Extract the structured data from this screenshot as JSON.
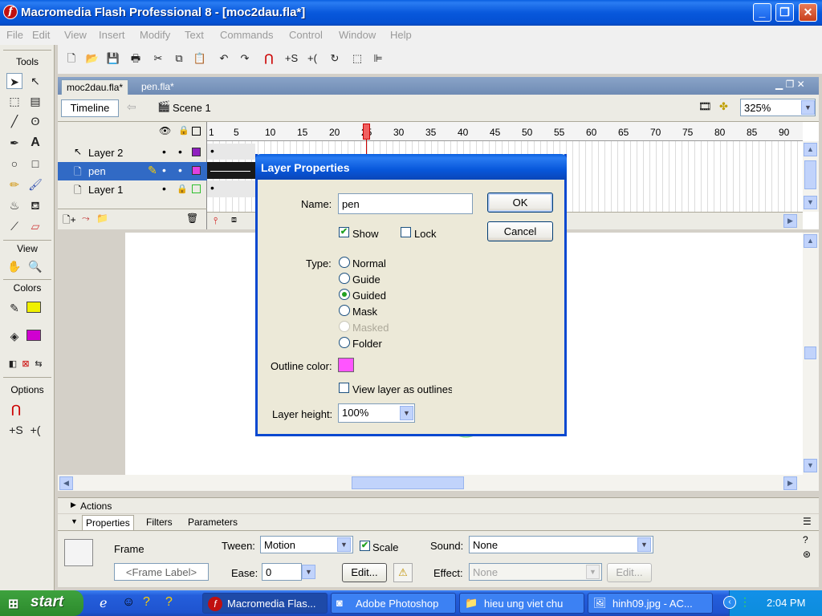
{
  "window": {
    "title": "Macromedia Flash Professional 8 - [moc2dau.fla*]",
    "logo_glyph": "f",
    "controls": {
      "minimize": "_",
      "maximize": "❐",
      "close": "✕"
    }
  },
  "menu": [
    "File",
    "Edit",
    "View",
    "Insert",
    "Modify",
    "Text",
    "Commands",
    "Control",
    "Window",
    "Help"
  ],
  "tools": {
    "title": "Tools",
    "view_label": "View",
    "colors_label": "Colors",
    "options_label": "Options",
    "stroke_color": "#f0f000",
    "fill_color": "#d000d0"
  },
  "doc_tabs": [
    "moc2dau.fla*",
    "pen.fla*"
  ],
  "timeline_bar": {
    "timeline_label": "Timeline",
    "scene_label": "Scene 1",
    "zoom": "325%"
  },
  "layers": [
    {
      "name": "Layer 2",
      "color": "#9020c0"
    },
    {
      "name": "pen",
      "color": "#e040e0"
    },
    {
      "name": "Layer 1",
      "color": "#30c030"
    }
  ],
  "ruler": [
    "1",
    "5",
    "10",
    "15",
    "20",
    "25",
    "30",
    "35",
    "40",
    "45",
    "50",
    "55",
    "60",
    "65",
    "70",
    "75",
    "80",
    "85",
    "90"
  ],
  "panels": {
    "actions_label": "Actions",
    "tabs": [
      "Properties",
      "Filters",
      "Parameters"
    ]
  },
  "properties": {
    "type_label": "Frame",
    "frame_label_placeholder": "<Frame Label>",
    "tween_label": "Tween:",
    "tween_value": "Motion",
    "scale_label": "Scale",
    "ease_label": "Ease:",
    "ease_value": "0",
    "edit_label": "Edit...",
    "sound_label": "Sound:",
    "sound_value": "None",
    "effect_label": "Effect:",
    "effect_value": "None",
    "effect_edit_label": "Edit..."
  },
  "dialog": {
    "title": "Layer Properties",
    "name_label": "Name:",
    "name_value": "pen",
    "ok_label": "OK",
    "cancel_label": "Cancel",
    "show_label": "Show",
    "lock_label": "Lock",
    "type_label": "Type:",
    "types": [
      "Normal",
      "Guide",
      "Guided",
      "Mask",
      "Masked",
      "Folder"
    ],
    "selected_type": "Guided",
    "outline_color_label": "Outline color:",
    "outline_color": "#ff55ff",
    "view_outlines_label": "View layer as outlines",
    "layer_height_label": "Layer height:",
    "layer_height_value": "100%"
  },
  "taskbar": {
    "start_label": "start",
    "apps": [
      "Macromedia Flas...",
      "Adobe Photoshop",
      "hieu ung viet chu",
      "hinh09.jpg - AC..."
    ],
    "clock": "2:04 PM"
  }
}
